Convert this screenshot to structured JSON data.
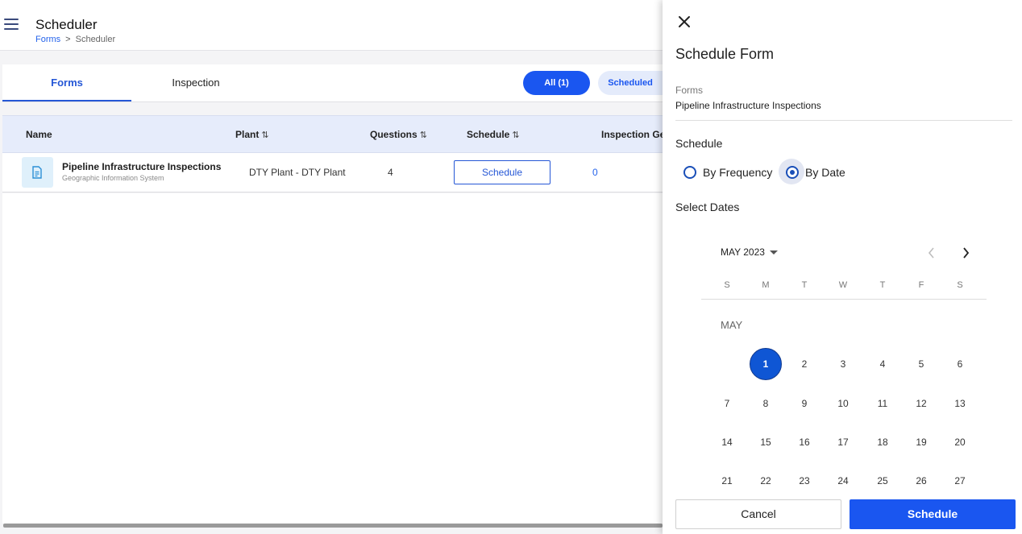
{
  "app": {
    "title": "Scheduler",
    "breadcrumb": [
      "Forms",
      "Scheduler"
    ],
    "breadcrumb_separator": ">"
  },
  "tabs": [
    {
      "label": "Forms",
      "active": true
    },
    {
      "label": "Inspection",
      "active": false
    }
  ],
  "filters": [
    {
      "label": "All (1)",
      "active": true
    },
    {
      "label": "Scheduled",
      "active": false
    }
  ],
  "table": {
    "columns": [
      {
        "label": "Name",
        "sortable": false
      },
      {
        "label": "Plant",
        "sortable": true
      },
      {
        "label": "Questions",
        "sortable": true
      },
      {
        "label": "Schedule",
        "sortable": true
      },
      {
        "label": "Inspection Ge",
        "sortable": false
      }
    ],
    "sort_icon": "sort-up-down-icon",
    "rows": [
      {
        "name": "Pipeline Infrastructure Inspections",
        "subtitle": "Geographic Information System",
        "plant": "DTY Plant - DTY Plant",
        "questions": "4",
        "schedule_button": "Schedule",
        "inspections_generated": "0",
        "icon": "document-icon"
      }
    ]
  },
  "panel": {
    "title": "Schedule Form",
    "forms_label": "Forms",
    "forms_value": "Pipeline Infrastructure Inspections",
    "schedule_label": "Schedule",
    "schedule_options": [
      {
        "label": "By Frequency",
        "selected": false
      },
      {
        "label": "By Date",
        "selected": true
      }
    ],
    "select_dates_label": "Select Dates",
    "calendar": {
      "month_year": "MAY 2023",
      "month_label": "MAY",
      "weekdays": [
        "S",
        "M",
        "T",
        "W",
        "T",
        "F",
        "S"
      ],
      "first_weekday_index": 1,
      "days_visible": 27,
      "selected_days": [
        1
      ]
    },
    "cancel_label": "Cancel",
    "submit_label": "Schedule"
  },
  "colors": {
    "accent": "#1a56f0",
    "selected_day": "#0f56d4",
    "link": "#2563eb"
  }
}
